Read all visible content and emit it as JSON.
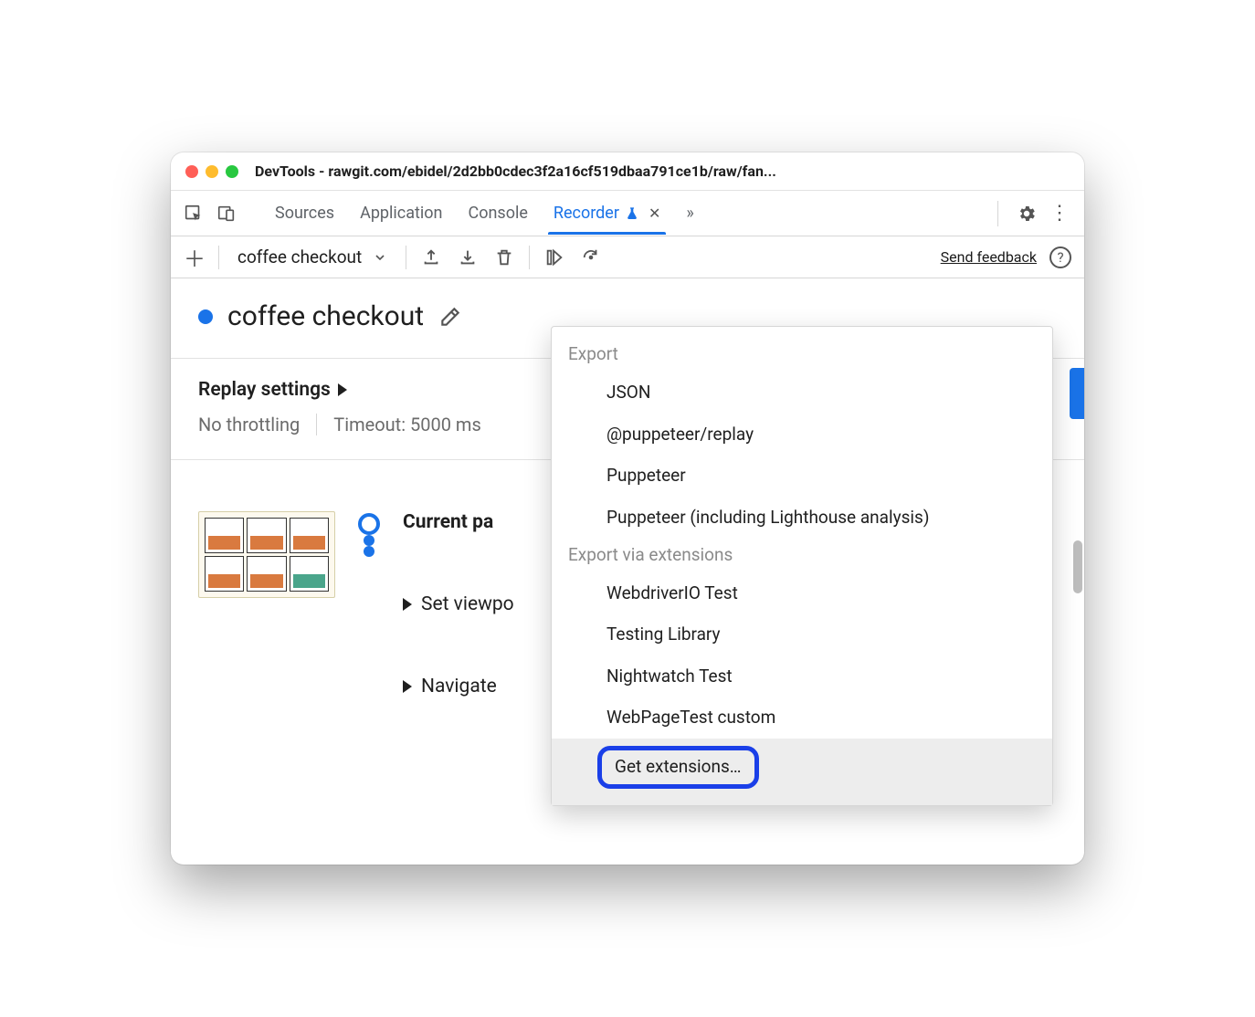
{
  "window": {
    "title": "DevTools - rawgit.com/ebidel/2d2bb0cdec3f2a16cf519dbaa791ce1b/raw/fan..."
  },
  "tabs": {
    "items": [
      "Sources",
      "Application",
      "Console",
      "Recorder"
    ],
    "active_index": 3
  },
  "toolbar": {
    "recording_name": "coffee checkout",
    "feedback_label": "Send feedback"
  },
  "recording": {
    "title": "coffee checkout"
  },
  "replay": {
    "heading": "Replay settings",
    "throttling": "No throttling",
    "timeout_label": "Timeout: 5000 ms"
  },
  "steps": {
    "current_label": "Current pa",
    "items": [
      "Set viewpo",
      "Navigate"
    ]
  },
  "dropdown": {
    "section1_title": "Export",
    "section1_items": [
      "JSON",
      "@puppeteer/replay",
      "Puppeteer",
      "Puppeteer (including Lighthouse analysis)"
    ],
    "section2_title": "Export via extensions",
    "section2_items": [
      "WebdriverIO Test",
      "Testing Library",
      "Nightwatch Test",
      "WebPageTest custom"
    ],
    "highlighted": "Get extensions…"
  }
}
